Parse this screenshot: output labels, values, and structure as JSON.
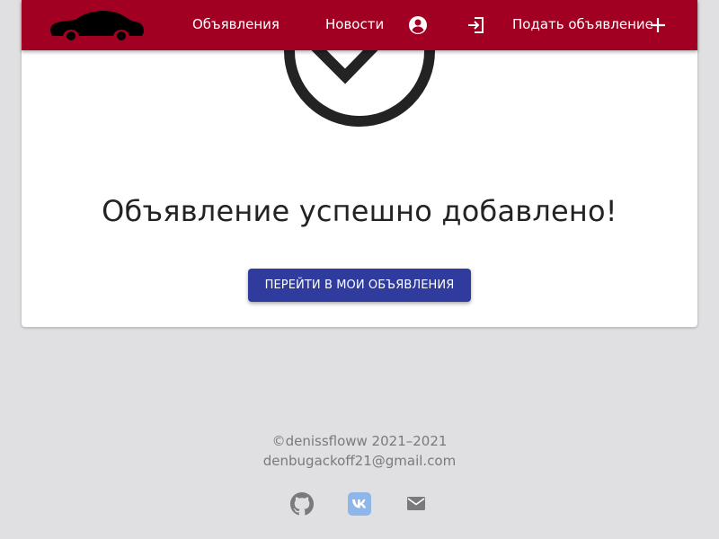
{
  "navbar": {
    "logo_icon": "car-silhouette-icon",
    "links": [
      {
        "label": "Объявления"
      },
      {
        "label": "Новости"
      }
    ],
    "account_icon": "account-circle-icon",
    "login_icon": "login-icon",
    "submit_label": "Подать объявление",
    "submit_icon": "plus-icon",
    "background_color": "#a10022"
  },
  "main": {
    "status_icon": "check-circle-icon",
    "message": "Объявление успешно добавлено!",
    "button_label": "Перейти в мои объявления",
    "button_color": "#2f3c9e"
  },
  "footer": {
    "copyright": "©denissfloww 2021–2021",
    "email": "denbugackoff21@gmail.com",
    "icons": [
      "github-icon",
      "vk-icon",
      "mail-icon"
    ],
    "vk_color": "#8fb6ea"
  }
}
